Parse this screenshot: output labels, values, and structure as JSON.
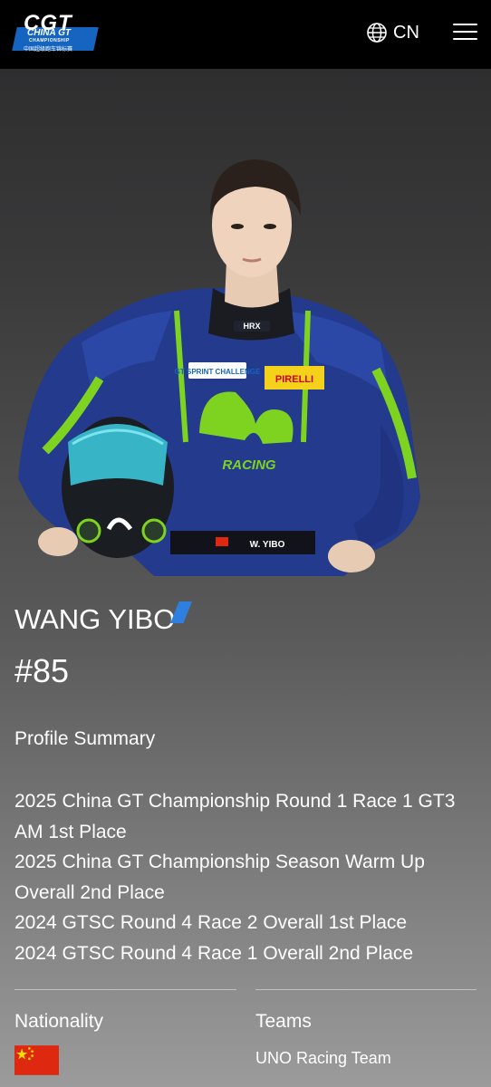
{
  "header": {
    "logo": {
      "mark": "CGT",
      "line1": "CHINA GT",
      "line2": "CHAMPIONSHIP",
      "line3": "中国超级跑车锦标赛"
    },
    "language": {
      "icon": "globe-icon",
      "code": "CN"
    },
    "menu_icon": "hamburger-menu-icon"
  },
  "driver": {
    "name": "WANG YIBO",
    "number": "#85",
    "suit_text": {
      "brand": "HRX",
      "sponsor": "PIRELLI",
      "series_badge": "GT SPRINT CHALLENGE",
      "team_mark": "RACING",
      "name_tag": "W. YIBO"
    }
  },
  "profile": {
    "title": "Profile Summary",
    "items": [
      "2025 China GT Championship Round 1 Race 1 GT3 AM 1st Place",
      "2025 China GT Championship Season Warm Up Overall 2nd Place",
      "2024 GTSC Round 4 Race 2 Overall 1st Place",
      "2024 GTSC Round 4 Race 1 Overall 2nd Place"
    ]
  },
  "details": {
    "nationality_label": "Nationality",
    "nationality_flag": "china-flag-icon",
    "teams_label": "Teams",
    "team": "UNO Racing Team"
  },
  "colors": {
    "header_bg": "#000000",
    "logo_blue": "#1565c0",
    "accent_blue": "#2f7fe0",
    "suit_blue": "#243a8c",
    "suit_green": "#7ed321"
  }
}
